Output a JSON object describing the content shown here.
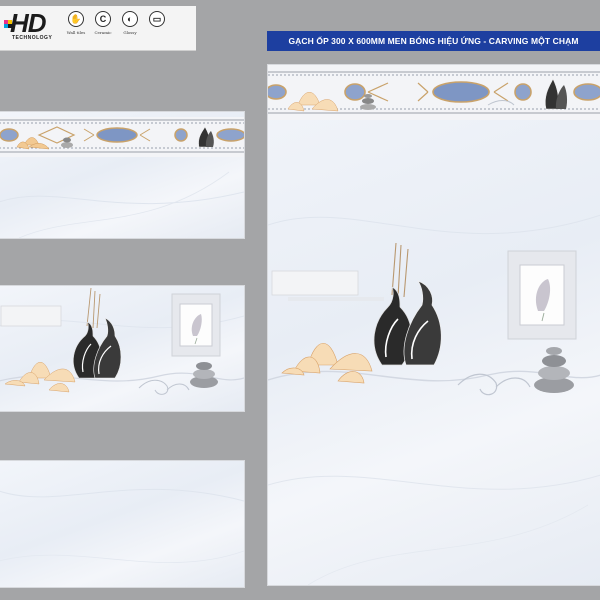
{
  "brand": {
    "logo_text": "HD",
    "logo_subtext": "TECHNOLOGY",
    "features": [
      {
        "icon": "hand-icon",
        "glyph": "✋",
        "label": "Wall tiles"
      },
      {
        "icon": "ceramic-icon",
        "glyph": "C",
        "label": "Ceramic"
      },
      {
        "icon": "glossy-icon",
        "glyph": "◐",
        "label": "Glossy"
      },
      {
        "icon": "size-icon",
        "glyph": "▭",
        "label": ""
      }
    ]
  },
  "product": {
    "title": "GẠCH ỐP 300 X 600MM MEN BÓNG HIỆU ỨNG - CARVING MỘT CHẠM"
  },
  "colors": {
    "background": "#a4a5a7",
    "title_bar": "#1d3fa0",
    "tile_base": "#eef2f8",
    "accent_blue": "#6f87b8",
    "accent_gold": "#c9a26a"
  }
}
